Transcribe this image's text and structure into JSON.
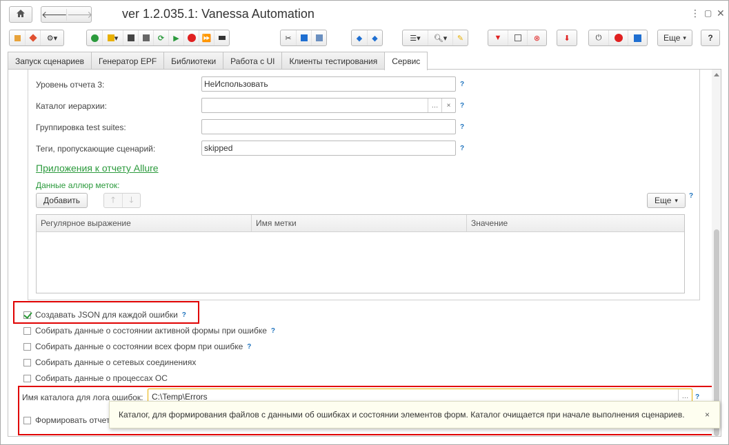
{
  "window": {
    "title": "ver 1.2.035.1: Vanessa Automation"
  },
  "toolbar": {
    "more_label": "Еще",
    "help_label": "?",
    "colors": {
      "green": "#2b9a3c",
      "red": "#e02020",
      "blue": "#1f6fd1",
      "yellow": "#e8b000"
    }
  },
  "tabs": [
    {
      "label": "Запуск сценариев"
    },
    {
      "label": "Генератор EPF"
    },
    {
      "label": "Библиотеки"
    },
    {
      "label": "Работа с UI"
    },
    {
      "label": "Клиенты тестирования"
    },
    {
      "label": "Сервис"
    }
  ],
  "form": {
    "report_level3": {
      "label": "Уровень отчета 3:",
      "value": "НеИспользовать"
    },
    "hierarchy_catalog": {
      "label": "Каталог иерархии:",
      "value": ""
    },
    "group_test_suites": {
      "label": "Группировка test suites:",
      "value": ""
    },
    "skip_tags": {
      "label": "Теги, пропускающие сценарий:",
      "value": "skipped"
    },
    "help_mark": "?",
    "allure_heading": "Приложения к отчету Allure",
    "allure_labels_caption": "Данные аллюр меток:",
    "add_button": "Добавить",
    "more_button": "Еще",
    "table": {
      "columns": [
        "Регулярное выражение",
        "Имя метки",
        "Значение"
      ],
      "rows": []
    },
    "checkboxes": [
      {
        "label": "Создавать JSON для каждой ошибки",
        "checked": true,
        "has_help": true
      },
      {
        "label": "Собирать данные о состоянии активной формы при ошибке",
        "checked": false,
        "has_help": true
      },
      {
        "label": "Собирать данные о состоянии всех форм при ошибке",
        "checked": false,
        "has_help": true
      },
      {
        "label": "Собирать данные о сетевых соединениях",
        "checked": false,
        "has_help": false
      },
      {
        "label": "Собирать данные о процессах ОС",
        "checked": false,
        "has_help": false
      }
    ],
    "error_log_dir": {
      "label": "Имя каталога для лога ошибок:",
      "value": "C:\\Temp\\Errors"
    },
    "generate_checkbox": {
      "label": "Формировать отчет",
      "checked": false
    }
  },
  "tooltip": {
    "text": "Каталог, для формирования файлов с данными об ошибках и состоянии элементов форм. Каталог очищается при начале выполнения сценариев.",
    "close": "×"
  }
}
